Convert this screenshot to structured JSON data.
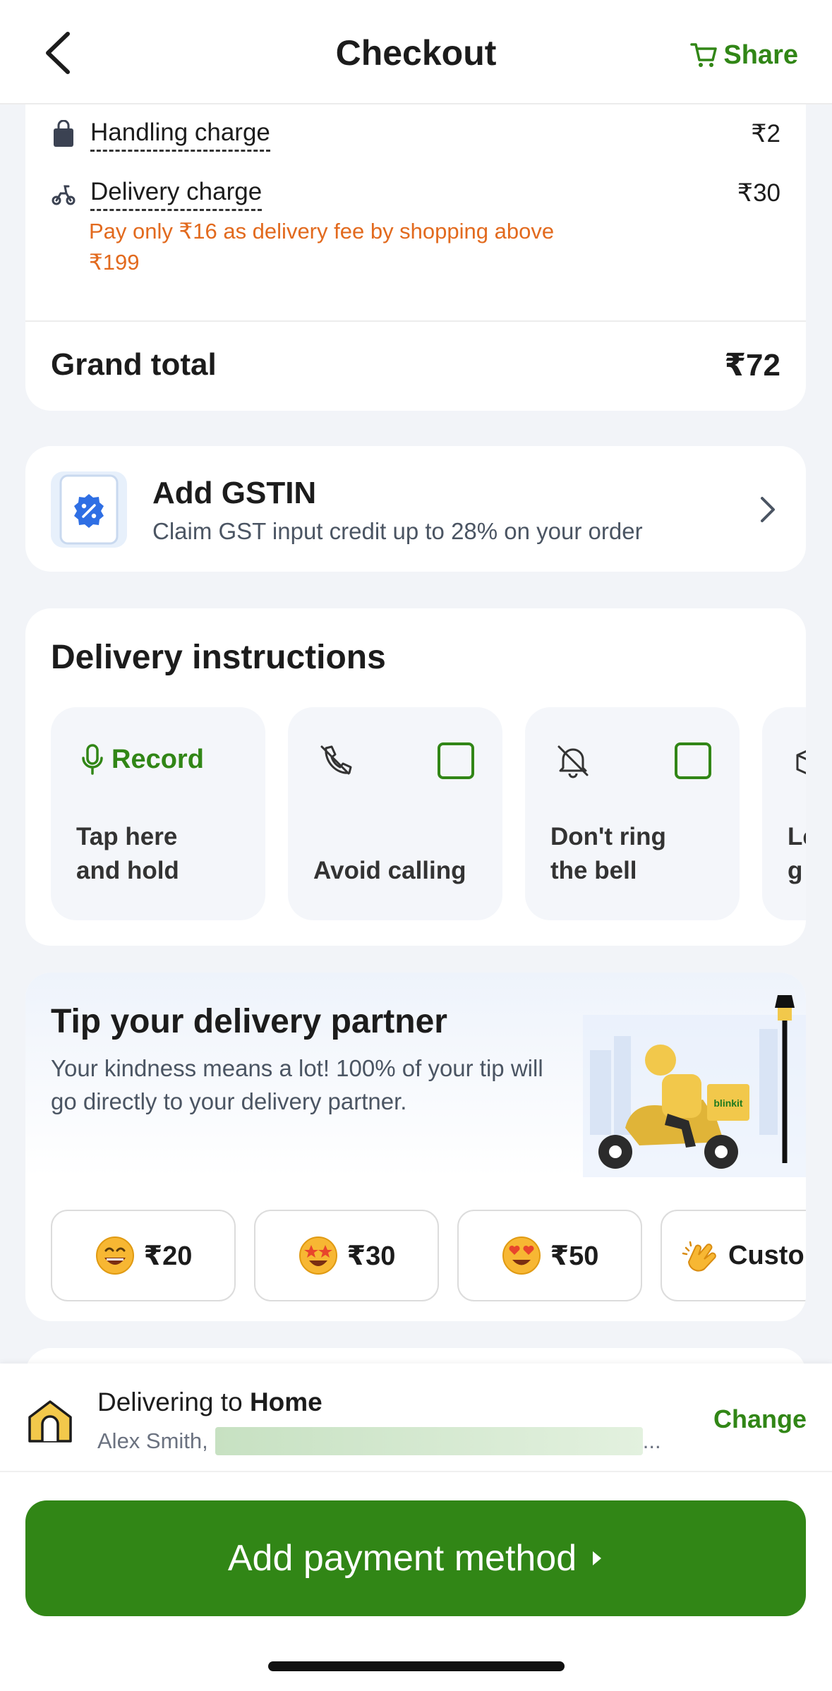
{
  "header": {
    "title": "Checkout",
    "share_label": "Share"
  },
  "bill": {
    "handling_label": "Handling charge",
    "handling_amount": "₹2",
    "delivery_label": "Delivery charge",
    "delivery_amount": "₹30",
    "delivery_promo": "Pay only ₹16 as delivery fee by shopping above ₹199",
    "grand_total_label": "Grand total",
    "grand_total_amount": "₹72"
  },
  "gstin": {
    "title": "Add GSTIN",
    "subtitle": "Claim GST input credit up to 28% on your order"
  },
  "delivery_instructions": {
    "title": "Delivery instructions",
    "items": [
      {
        "action": "Record",
        "label": "Tap here and hold"
      },
      {
        "label": "Avoid calling"
      },
      {
        "label": "Don't ring the bell"
      },
      {
        "label": "Le g"
      }
    ]
  },
  "tip": {
    "title": "Tip your delivery partner",
    "description": "Your kindness means a lot! 100% of your tip will go directly to your delivery partner.",
    "illustration_text": "blinkit",
    "options": [
      {
        "label": "₹20",
        "icon": "grinning-emoji-icon"
      },
      {
        "label": "₹30",
        "icon": "star-eyes-emoji-icon"
      },
      {
        "label": "₹50",
        "icon": "heart-eyes-emoji-icon"
      },
      {
        "label": "Custo",
        "icon": "clapping-hands-icon"
      }
    ]
  },
  "address": {
    "prefix": "Delivering to ",
    "place": "Home",
    "name": "Alex Smith,",
    "ellipsis": "...",
    "change_label": "Change"
  },
  "payment": {
    "button_label": "Add payment method"
  },
  "colors": {
    "brand_green": "#318616",
    "promo_orange": "#e26a1e"
  }
}
